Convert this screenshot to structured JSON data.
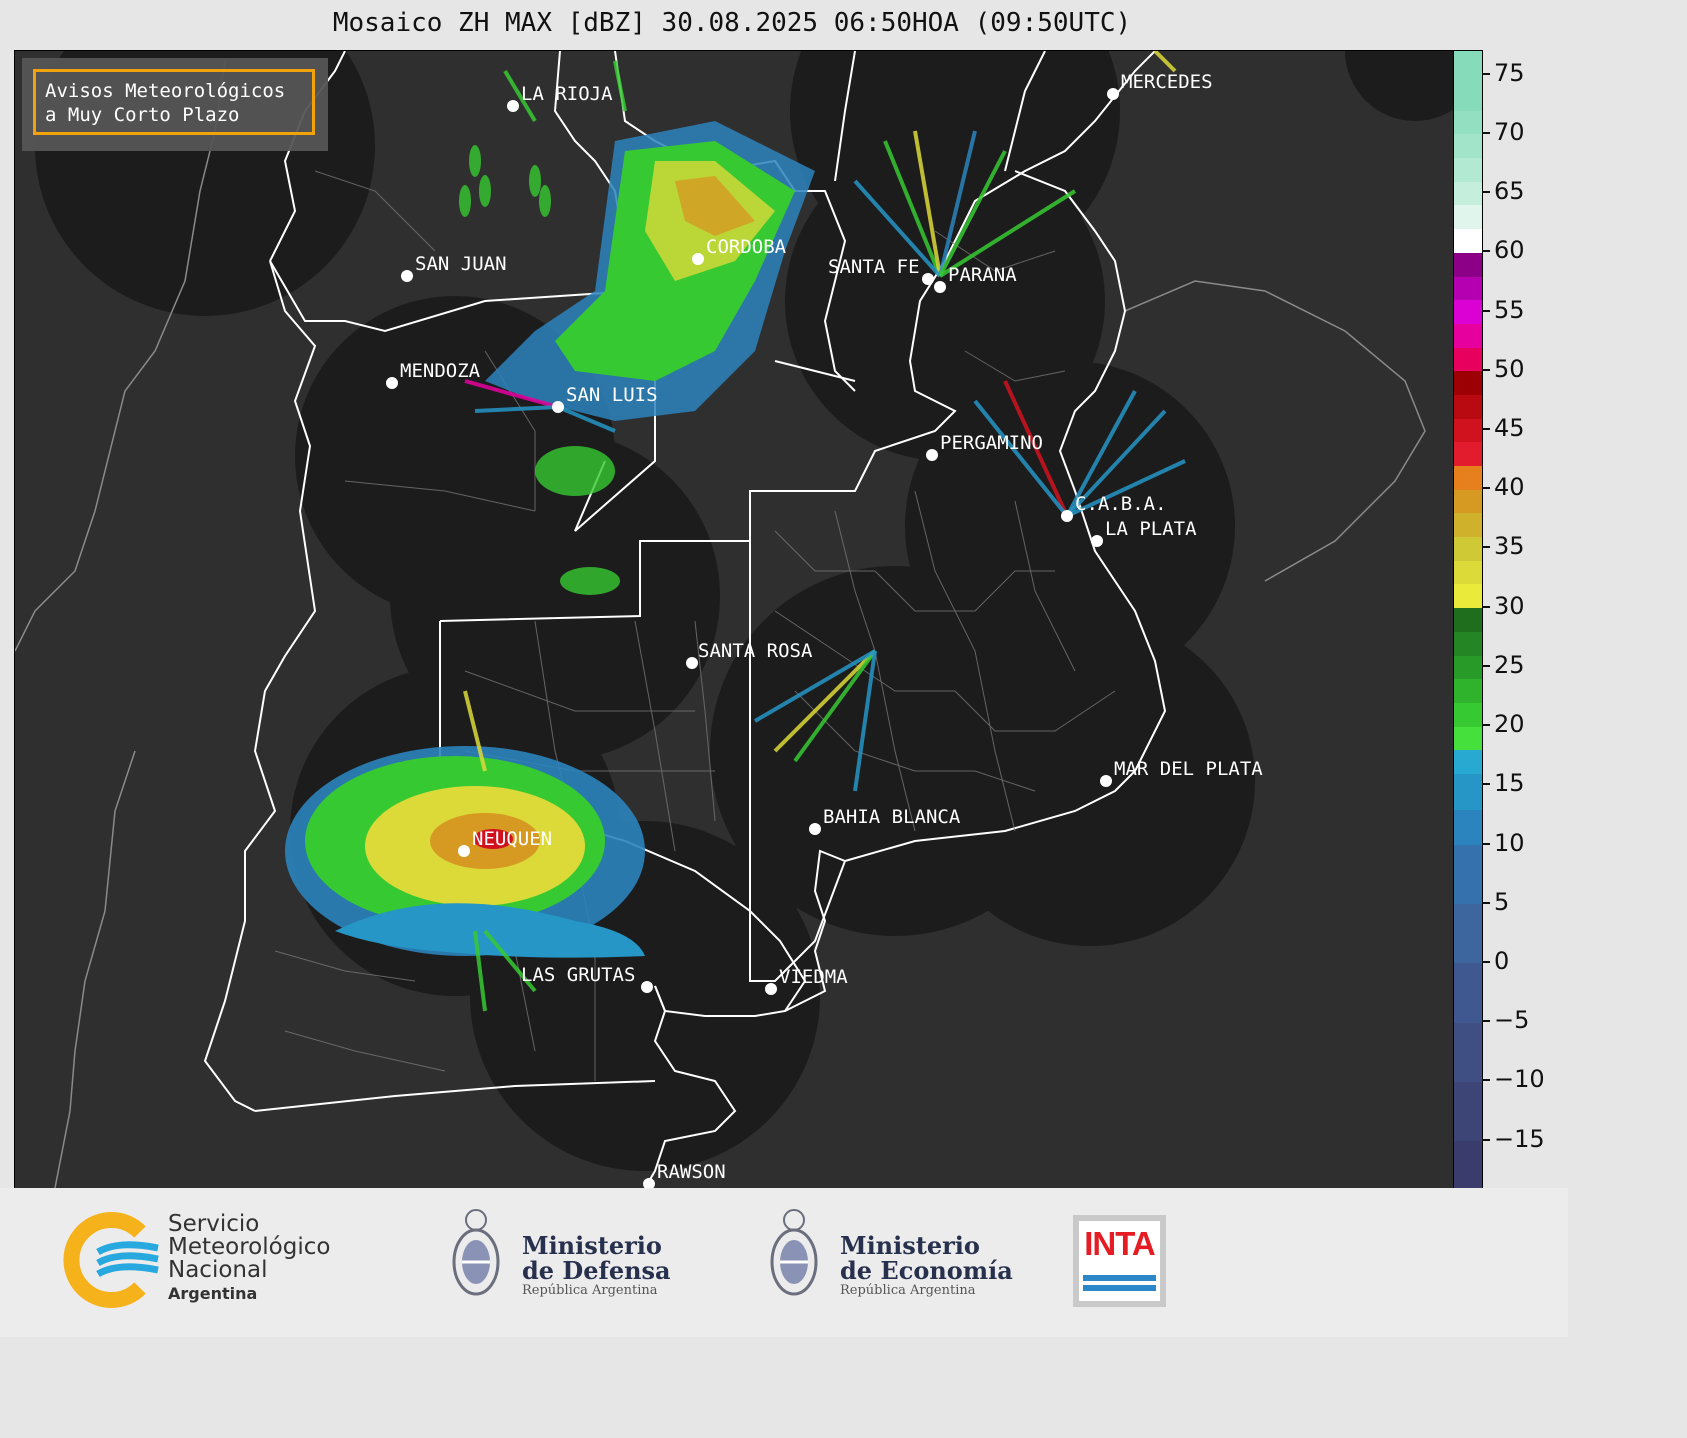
{
  "title": "Mosaico ZH MAX [dBZ] 30.08.2025 06:50HOA (09:50UTC)",
  "warning_box": {
    "line1": "Avisos Meteorológicos",
    "line2": "a Muy Corto Plazo",
    "border_color": "#f2a20b"
  },
  "cities": [
    {
      "name": "LA RIOJA"
    },
    {
      "name": "MERCEDES"
    },
    {
      "name": "SAN JUAN"
    },
    {
      "name": "CORDOBA"
    },
    {
      "name": "SANTA FE"
    },
    {
      "name": "PARANA"
    },
    {
      "name": "MENDOZA"
    },
    {
      "name": "SAN LUIS"
    },
    {
      "name": "PERGAMINO"
    },
    {
      "name": "C.A.B.A."
    },
    {
      "name": "LA PLATA"
    },
    {
      "name": "SANTA ROSA"
    },
    {
      "name": "MAR DEL PLATA"
    },
    {
      "name": "BAHIA BLANCA"
    },
    {
      "name": "NEUQUEN"
    },
    {
      "name": "LAS GRUTAS"
    },
    {
      "name": "VIEDMA"
    },
    {
      "name": "RAWSON"
    }
  ],
  "colorbar": {
    "unit": "dBZ",
    "range": [
      -19,
      77
    ],
    "tick_labels": [
      "75",
      "70",
      "65",
      "60",
      "55",
      "50",
      "45",
      "40",
      "35",
      "30",
      "25",
      "20",
      "15",
      "10",
      "5",
      "0",
      "−5",
      "−10",
      "−15"
    ],
    "tick_values": [
      75,
      70,
      65,
      60,
      55,
      50,
      45,
      40,
      35,
      30,
      25,
      20,
      15,
      10,
      5,
      0,
      -5,
      -10,
      -15
    ],
    "color_scale": [
      {
        "from": -19,
        "to": -15,
        "color": "#3a3d6b"
      },
      {
        "from": -15,
        "to": -10,
        "color": "#3d4577"
      },
      {
        "from": -10,
        "to": -5,
        "color": "#3f4e83"
      },
      {
        "from": -5,
        "to": 0,
        "color": "#3f5890"
      },
      {
        "from": 0,
        "to": 5,
        "color": "#3d659e"
      },
      {
        "from": 5,
        "to": 10,
        "color": "#3572ad"
      },
      {
        "from": 10,
        "to": 13,
        "color": "#2b84bd"
      },
      {
        "from": 13,
        "to": 16,
        "color": "#2596c6"
      },
      {
        "from": 16,
        "to": 18,
        "color": "#27a9d2"
      },
      {
        "from": 18,
        "to": 20,
        "color": "#45e03b"
      },
      {
        "from": 20,
        "to": 22,
        "color": "#37c932"
      },
      {
        "from": 22,
        "to": 24,
        "color": "#2fb22c"
      },
      {
        "from": 24,
        "to": 26,
        "color": "#289a28"
      },
      {
        "from": 26,
        "to": 28,
        "color": "#238523"
      },
      {
        "from": 28,
        "to": 30,
        "color": "#1e6e1e"
      },
      {
        "from": 30,
        "to": 32,
        "color": "#eaea3a"
      },
      {
        "from": 32,
        "to": 34,
        "color": "#dcda38"
      },
      {
        "from": 34,
        "to": 36,
        "color": "#cfc935"
      },
      {
        "from": 36,
        "to": 38,
        "color": "#d0b12c"
      },
      {
        "from": 38,
        "to": 40,
        "color": "#d69a22"
      },
      {
        "from": 40,
        "to": 42,
        "color": "#e5801c"
      },
      {
        "from": 42,
        "to": 44,
        "color": "#e21c2c"
      },
      {
        "from": 44,
        "to": 46,
        "color": "#d0121f"
      },
      {
        "from": 46,
        "to": 48,
        "color": "#b80a10"
      },
      {
        "from": 48,
        "to": 50,
        "color": "#9c0005"
      },
      {
        "from": 50,
        "to": 52,
        "color": "#e8005f"
      },
      {
        "from": 52,
        "to": 54,
        "color": "#e6009e"
      },
      {
        "from": 54,
        "to": 56,
        "color": "#db00d4"
      },
      {
        "from": 56,
        "to": 58,
        "color": "#b500b2"
      },
      {
        "from": 58,
        "to": 60,
        "color": "#8c0087"
      },
      {
        "from": 60,
        "to": 62,
        "color": "#ffffff"
      },
      {
        "from": 62,
        "to": 64,
        "color": "#e0f5ec"
      },
      {
        "from": 64,
        "to": 66,
        "color": "#c6eedd"
      },
      {
        "from": 66,
        "to": 68,
        "color": "#b2e9d3"
      },
      {
        "from": 68,
        "to": 70,
        "color": "#a1e4c9"
      },
      {
        "from": 70,
        "to": 72,
        "color": "#92e0c1"
      },
      {
        "from": 72,
        "to": 77,
        "color": "#85dbba"
      }
    ]
  },
  "footer": {
    "smn": {
      "line1": "Servicio",
      "line2": "Meteorológico",
      "line3": "Nacional",
      "line4": "Argentina"
    },
    "defensa": {
      "line1": "Ministerio",
      "line2": "de Defensa",
      "line3": "República Argentina"
    },
    "economia": {
      "line1": "Ministerio",
      "line2": "de Economía",
      "line3": "República Argentina"
    },
    "inta": {
      "label": "INTA"
    }
  },
  "colors": {
    "background_land": "#2f2f2f",
    "radar_coverage": "#1c1c1c",
    "boundaries": "#ffffff"
  }
}
